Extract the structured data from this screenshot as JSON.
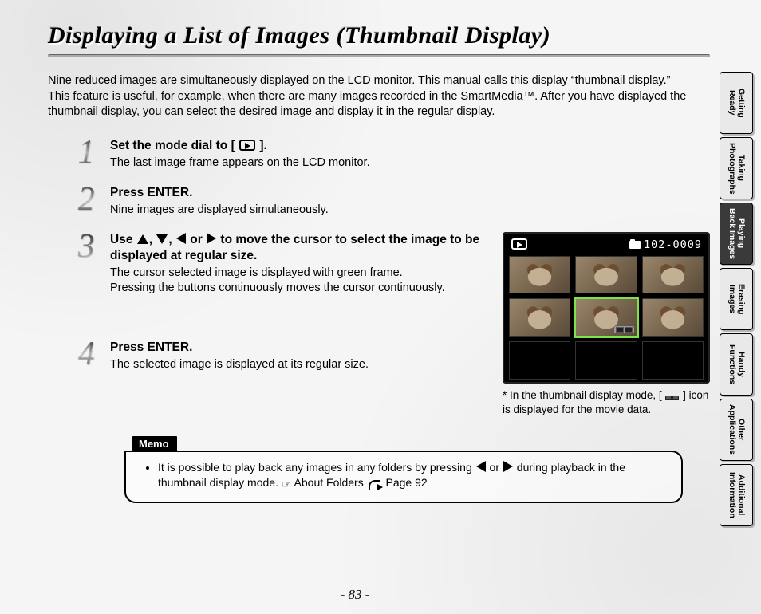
{
  "title": "Displaying a List of Images (Thumbnail Display)",
  "intro": "Nine reduced images are simultaneously displayed on the LCD monitor. This manual calls this display “thumbnail display.”\nThis feature is useful, for example, when there are many images recorded in the SmartMedia™. After you have displayed the thumbnail display, you can select the desired image and display it in the regular display.",
  "steps": {
    "s1": {
      "num": "1",
      "title_pre": "Set the mode dial to [",
      "title_post": " ].",
      "desc": "The last image frame appears on the LCD monitor."
    },
    "s2": {
      "num": "2",
      "title": "Press ENTER.",
      "desc": "Nine images are displayed simultaneously."
    },
    "s3": {
      "num": "3",
      "title_pre": "Use ",
      "title_mid1": ", ",
      "title_mid2": ", ",
      "title_mid3": " or ",
      "title_post": " to move the cursor to select the image to be displayed at regular size.",
      "desc": "The cursor selected image is displayed with green frame.\nPressing the buttons continuously moves the cursor continuously."
    },
    "s4": {
      "num": "4",
      "title": "Press ENTER.",
      "desc": "The selected image is displayed at its regular size."
    }
  },
  "lcd": {
    "counter": "102-0009"
  },
  "lcd_note": {
    "pre": "*  In the thumbnail display mode, [ ",
    "post": " ] icon is displayed for the movie data."
  },
  "memo": {
    "label": "Memo",
    "item_pre": "It is possible to play back any images in any folders by pressing ",
    "item_mid": " or ",
    "item_post1": " during playback in the thumbnail display mode. ",
    "item_ref": " About Folders ",
    "item_page": " Page 92"
  },
  "page_number": "- 83 -",
  "tabs": [
    {
      "label": "Getting\nReady",
      "active": false
    },
    {
      "label": "Taking\nPhotographs",
      "active": false
    },
    {
      "label": "Playing\nBack Images",
      "active": true
    },
    {
      "label": "Erasing\nImages",
      "active": false
    },
    {
      "label": "Handy\nFunctions",
      "active": false
    },
    {
      "label": "Other\nApplications",
      "active": false
    },
    {
      "label": "Additional\nInformation",
      "active": false
    }
  ]
}
